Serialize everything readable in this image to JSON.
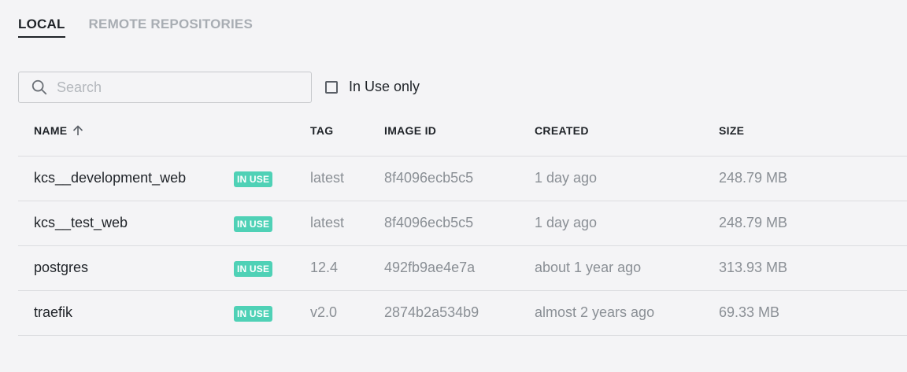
{
  "tabs": [
    {
      "label": "LOCAL",
      "active": true
    },
    {
      "label": "REMOTE REPOSITORIES",
      "active": false
    }
  ],
  "search": {
    "placeholder": "Search",
    "value": ""
  },
  "filter": {
    "label": "In Use only",
    "checked": false
  },
  "table": {
    "columns": {
      "name": "NAME",
      "tag": "TAG",
      "image_id": "IMAGE ID",
      "created": "CREATED",
      "size": "SIZE"
    },
    "sort": {
      "column": "name",
      "direction": "asc",
      "icon": "arrow-up-icon"
    },
    "rows": [
      {
        "name": "kcs__development_web",
        "badge": "IN USE",
        "tag": "latest",
        "image_id": "8f4096ecb5c5",
        "created": "1 day ago",
        "size": "248.79 MB"
      },
      {
        "name": "kcs__test_web",
        "badge": "IN USE",
        "tag": "latest",
        "image_id": "8f4096ecb5c5",
        "created": "1 day ago",
        "size": "248.79 MB"
      },
      {
        "name": "postgres",
        "badge": "IN USE",
        "tag": "12.4",
        "image_id": "492fb9ae4e7a",
        "created": "about 1 year ago",
        "size": "313.93 MB"
      },
      {
        "name": "traefik",
        "badge": "IN USE",
        "tag": "v2.0",
        "image_id": "2874b2a534b9",
        "created": "almost 2 years ago",
        "size": "69.33 MB"
      }
    ]
  },
  "colors": {
    "badge": "#4fd1b6",
    "background": "#f4f4f6",
    "muted_text": "#8a8f95"
  }
}
